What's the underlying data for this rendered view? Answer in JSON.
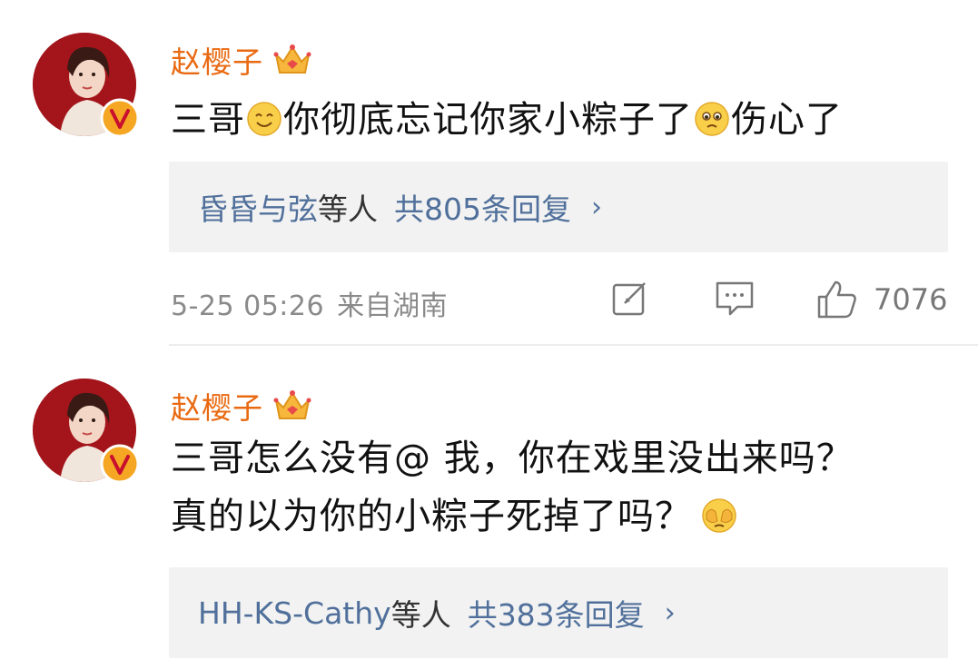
{
  "comments": [
    {
      "username": "赵樱子",
      "text_parts": [
        "三哥",
        "你彻底忘记你家小粽子了",
        "伤心了"
      ],
      "emojis": [
        "smile-emoji",
        "pitiful-emoji"
      ],
      "replies": {
        "who": "昏昏与弦",
        "others": "等人",
        "total": "共805条回复",
        "chevron": "›"
      },
      "timestamp": "5-25 05:26",
      "location": "来自湖南",
      "like_count": "7076"
    },
    {
      "username": "赵樱子",
      "line1": "三哥怎么没有@ 我，你在戏里没出来吗？",
      "line2": "真的以为你的小粽子死掉了吗？",
      "emojis": [
        "cover-face-emoji"
      ],
      "replies": {
        "who": "HH-KS-Cathy",
        "others": "等人",
        "total": "共383条回复",
        "chevron": "›"
      }
    }
  ],
  "colors": {
    "username": "#e96a12",
    "link": "#50709b",
    "reply_bg": "#f2f2f2",
    "meta": "#8a8a8a",
    "verified_badge": "#f5a623"
  },
  "icons": [
    "avatar",
    "verified-badge",
    "crown-icon",
    "repost-icon",
    "comment-icon",
    "like-icon"
  ]
}
